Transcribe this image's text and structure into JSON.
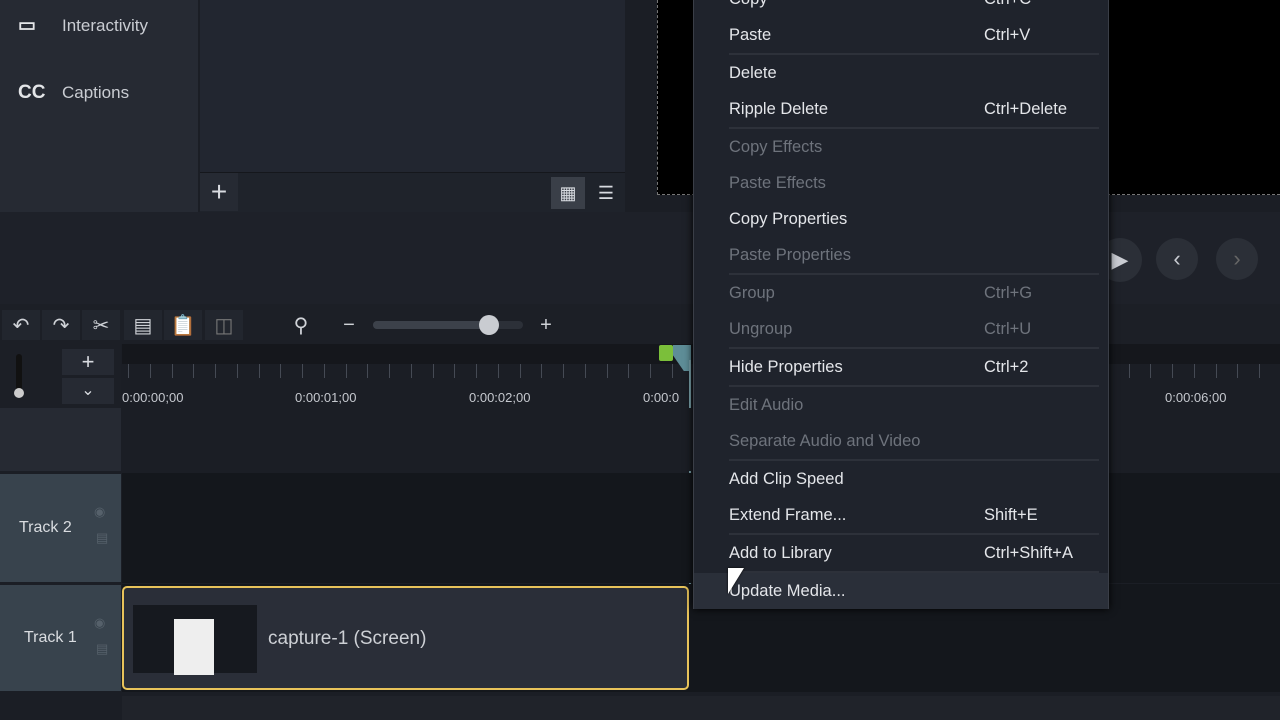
{
  "sidebar": {
    "items": [
      {
        "label": "Interactivity",
        "icon": "interactivity-icon"
      },
      {
        "label": "Captions",
        "icon": "CC"
      }
    ]
  },
  "bin": {
    "add": "+"
  },
  "toolbar": {
    "zoom_level": 0.8
  },
  "timeline": {
    "ruler": [
      "0:00:00;00",
      "0:00:01;00",
      "0:00:02;00",
      "0:00:0",
      "0:00:06;00"
    ],
    "tracks": [
      {
        "name": "Track 2"
      },
      {
        "name": "Track 1"
      }
    ],
    "clip": {
      "label": "capture-1 (Screen)"
    }
  },
  "context_menu": {
    "items": [
      {
        "label": "Copy",
        "shortcut": "Ctrl+C",
        "disabled": false
      },
      {
        "label": "Paste",
        "shortcut": "Ctrl+V",
        "disabled": false,
        "sep": true
      },
      {
        "label": "Delete",
        "shortcut": "",
        "disabled": false
      },
      {
        "label": "Ripple Delete",
        "shortcut": "Ctrl+Delete",
        "disabled": false,
        "sep": true
      },
      {
        "label": "Copy Effects",
        "shortcut": "",
        "disabled": true
      },
      {
        "label": "Paste Effects",
        "shortcut": "",
        "disabled": true
      },
      {
        "label": "Copy Properties",
        "shortcut": "",
        "disabled": false
      },
      {
        "label": "Paste Properties",
        "shortcut": "",
        "disabled": true,
        "sep": true
      },
      {
        "label": "Group",
        "shortcut": "Ctrl+G",
        "disabled": true
      },
      {
        "label": "Ungroup",
        "shortcut": "Ctrl+U",
        "disabled": true,
        "sep": true
      },
      {
        "label": "Hide Properties",
        "shortcut": "Ctrl+2",
        "disabled": false,
        "sep": true
      },
      {
        "label": "Edit Audio",
        "shortcut": "",
        "disabled": true
      },
      {
        "label": "Separate Audio and Video",
        "shortcut": "",
        "disabled": true,
        "sep": true
      },
      {
        "label": "Add Clip Speed",
        "shortcut": "",
        "disabled": false
      },
      {
        "label": "Extend Frame...",
        "shortcut": "Shift+E",
        "disabled": false,
        "sep": true
      },
      {
        "label": "Add to Library",
        "shortcut": "Ctrl+Shift+A",
        "disabled": false,
        "sep": true
      },
      {
        "label": "Update Media...",
        "shortcut": "",
        "disabled": false,
        "highlighted": true
      }
    ]
  }
}
